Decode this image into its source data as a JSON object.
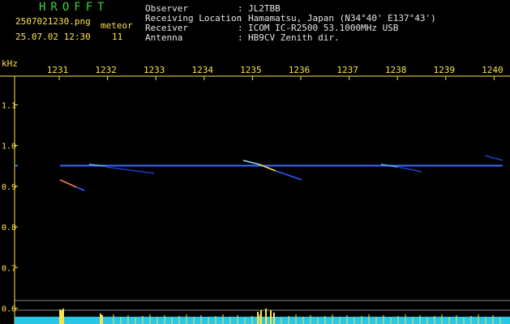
{
  "app": {
    "logo": "HROFFT",
    "filename": "2507021230.png",
    "datetime": "25.07.02 12:30",
    "meteor_label": "meteor",
    "meteor_count": "11"
  },
  "info": {
    "rows": [
      {
        "label": "Observer",
        "sep": ":",
        "value": "JL2TBB"
      },
      {
        "label": "Receiving Location",
        "sep": ":",
        "value": "Hamamatsu, Japan (N34°40' E137°43')"
      },
      {
        "label": "Receiver",
        "sep": ":",
        "value": "ICOM IC-R2500 53.1000MHz USB"
      },
      {
        "label": "Antenna",
        "sep": ":",
        "value": "HB9CV Zenith dir."
      }
    ]
  },
  "spectrogram": {
    "y_unit": "kHz",
    "y_ticks": [
      "1.1",
      "1.0",
      "0.9",
      "0.8",
      "0.7",
      "0.6"
    ],
    "x_ticks": [
      "1231",
      "1232",
      "1233",
      "1234",
      "1235",
      "1236",
      "1237",
      "1238",
      "1239",
      "1240"
    ],
    "colors": {
      "axis": "#ffe24a",
      "carrier": "#3a6cff",
      "activity": "#29c6e6",
      "grid": "#8a8a8a"
    }
  }
}
